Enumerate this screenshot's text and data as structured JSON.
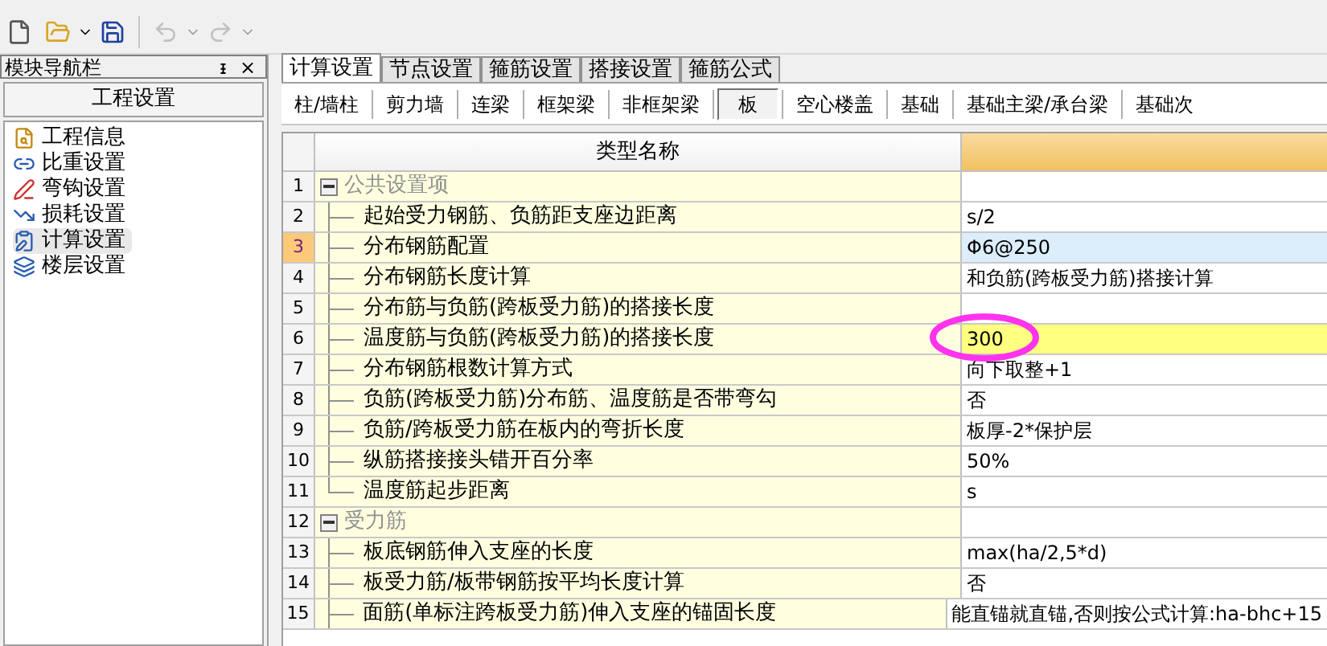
{
  "toolbar": {
    "undo_disabled": true,
    "redo_disabled": true
  },
  "sidebar": {
    "title": "模块导航栏",
    "pin": "ᵻ",
    "close": "×",
    "section": "工程设置",
    "items": [
      {
        "label": "工程信息",
        "kind": "info",
        "selected": false
      },
      {
        "label": "比重设置",
        "kind": "weight",
        "selected": false
      },
      {
        "label": "弯钩设置",
        "kind": "hook",
        "selected": false
      },
      {
        "label": "损耗设置",
        "kind": "loss",
        "selected": false
      },
      {
        "label": "计算设置",
        "kind": "calc",
        "selected": true
      },
      {
        "label": "楼层设置",
        "kind": "floor",
        "selected": false
      }
    ]
  },
  "tabs": [
    {
      "label": "计算设置",
      "selected": true
    },
    {
      "label": "节点设置",
      "selected": false
    },
    {
      "label": "箍筋设置",
      "selected": false
    },
    {
      "label": "搭接设置",
      "selected": false
    },
    {
      "label": "箍筋公式",
      "selected": false
    }
  ],
  "subtabs": [
    {
      "label": "柱/墙柱",
      "selected": false
    },
    {
      "label": "剪力墙",
      "selected": false
    },
    {
      "label": "连梁",
      "selected": false
    },
    {
      "label": "框架梁",
      "selected": false
    },
    {
      "label": "非框架梁",
      "selected": false
    },
    {
      "label": "板",
      "selected": true
    },
    {
      "label": "空心楼盖",
      "selected": false
    },
    {
      "label": "基础",
      "selected": false
    },
    {
      "label": "基础主梁/承台梁",
      "selected": false
    },
    {
      "label": "基础次",
      "selected": false
    }
  ],
  "table": {
    "columns": [
      "类型名称"
    ],
    "rows": [
      {
        "num": "1",
        "kind": "group",
        "name": "公共设置项",
        "expanded": true,
        "selected": false
      },
      {
        "num": "2",
        "kind": "item",
        "name": "起始受力钢筋、负筋距支座边距离",
        "value": "s/2",
        "selected": false,
        "highlighted": false
      },
      {
        "num": "3",
        "kind": "item",
        "name": "分布钢筋配置",
        "value": "Φ6@250",
        "selected": true,
        "highlighted": false
      },
      {
        "num": "4",
        "kind": "item",
        "name": "分布钢筋长度计算",
        "value": "和负筋(跨板受力筋)搭接计算",
        "selected": false,
        "highlighted": false
      },
      {
        "num": "5",
        "kind": "item",
        "name": "分布筋与负筋(跨板受力筋)的搭接长度",
        "selected": false,
        "highlighted": false
      },
      {
        "num": "6",
        "kind": "item",
        "name": "温度筋与负筋(跨板受力筋)的搭接长度",
        "value": "300",
        "selected": false,
        "highlighted": true
      },
      {
        "num": "7",
        "kind": "item",
        "name": "分布钢筋根数计算方式",
        "value": "向下取整+1",
        "selected": false,
        "highlighted": false
      },
      {
        "num": "8",
        "kind": "item",
        "name": "负筋(跨板受力筋)分布筋、温度筋是否带弯勾",
        "value": "否",
        "selected": false,
        "highlighted": false
      },
      {
        "num": "9",
        "kind": "item",
        "name": "负筋/跨板受力筋在板内的弯折长度",
        "value": "板厚-2*保护层",
        "selected": false,
        "highlighted": false
      },
      {
        "num": "10",
        "kind": "item",
        "name": "纵筋搭接接头错开百分率",
        "value": "50%",
        "selected": false,
        "highlighted": false
      },
      {
        "num": "11",
        "kind": "item",
        "name": "温度筋起步距离",
        "value": "s",
        "selected": false,
        "highlighted": false
      },
      {
        "num": "12",
        "kind": "group",
        "name": "受力筋",
        "expanded": true,
        "selected": false
      },
      {
        "num": "13",
        "kind": "item",
        "name": "板底钢筋伸入支座的长度",
        "value": "max(ha/2,5*d)",
        "selected": false,
        "highlighted": false
      },
      {
        "num": "14",
        "kind": "item",
        "name": "板受力筋/板带钢筋按平均长度计算",
        "value": "否",
        "selected": false,
        "highlighted": false
      },
      {
        "num": "15",
        "kind": "item",
        "name": "面筋(单标注跨板受力筋)伸入支座的锚固长度",
        "value": "能直锚就直锚,否则按公式计算:ha-bhc+15",
        "selected": false,
        "highlighted": false
      }
    ]
  },
  "annotation": {
    "kind": "ellipse",
    "color": "#ff33ee"
  }
}
